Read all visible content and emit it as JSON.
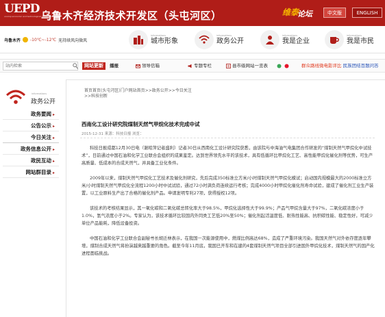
{
  "header": {
    "logo_text": "UEPD",
    "logo_sub": "urumqi economic and technological development zone",
    "site_title": "乌鲁木齐经济技术开发区（头屯河区）",
    "forum_badge_1": "维泰",
    "forum_badge_2": "论坛",
    "lang_cn": "中文版",
    "lang_en": "ENGLISH",
    "colors": {
      "brand": "#b01d18",
      "accent_yellow": "#f5b400"
    }
  },
  "weather": {
    "place": "乌鲁木齐",
    "temp": "-10℃~-12℃",
    "desc": "无持续风向微风"
  },
  "nav": [
    {
      "en": "informations",
      "cn": "城市形象",
      "icon": "building-icon"
    },
    {
      "en": "informations",
      "cn": "政务公开",
      "icon": "wifi-icon"
    },
    {
      "en": "informations",
      "cn": "我是企业",
      "icon": "person-icon"
    },
    {
      "en": "informations",
      "cn": "我是市民",
      "icon": "cup-icon"
    }
  ],
  "toolbar": {
    "search_placeholder": "站内检索",
    "tag": "网站更新",
    "tag_tail": "播报",
    "links": [
      "领导信箱",
      "专题专栏",
      "县市级网站一览表",
      "微信",
      "微博"
    ],
    "marquee_1": "群众路线微电影评比",
    "marquee_2": "民族团结百题问答"
  },
  "sidebar": {
    "en": "informations",
    "title": "政务公开",
    "items": [
      "政务要闻",
      "公告公示",
      "今日关注",
      "政务信息公开",
      "政民互动",
      "网站群目录"
    ]
  },
  "article": {
    "crumb": "首页首页(头屯河区)门户网站首页>>政务公开>>今日关注>>科技创新",
    "title": "西南化工设计研究院煤制天然气甲烷化技术完成中试",
    "meta": "2015-12-31 来源：科技日报 浏览：",
    "paragraphs": [
      "科技日报成都12月30日电（谢昭萍记者盛利）记者30日从西南化工设计研究院获悉，由该院与中海油气电集团合作研发的“煤制天然气甲烷化中试技术”，日前通过中国石油和化学工业联合会组织的成果鉴定。达到世界领先水平的该技术，具有低循环比甲烷化工艺、高性能甲烷化催化剂等优势，可生产高质量、低成本的合成天然气，并具备工业化条件。",
      "2009年以来，煤制天然气甲烷化工艺技术及催化剂研究，先后完成350标准立方米/小时煤制天然气甲烷化模试；启动国内规模最大的2000标准立方米/小时煤制天然气甲烷化全流程1200小时中试试验，通过72小时满负荷连续运行考核；完成4000小时甲烷化催化剂寿命试验，建成了催化剂工业生产装置，以工业原料生产出了合格的催化剂产品。申请发明专利27项，获得授权12项。",
      "该技术的考核结果显示，其一氧化碳和二氧化碳总转化率大于98.5%，甲烷化选择性大于99.9%；产品气甲烷含量大于97%，二氧化碳浓度小于1.0%，氢气浓度小于2%。专家认为，该技术循环比较国内外同类工艺低20%至50%；催化剂起活温度低、耐热性能高、抗积碳性能、稳定性好，可减少单位产品能耗，降低设备投资。",
      "中国石油和化学工业联合会副秘书长胡迁林表示，在我国一次能源使用中，燃煤比例高达68%，造成了严重环境污染。我国天然气对外依存度逐年攀增，煤制合成天然气将扮演越来越重要的角色。截至今年11月底，我国已开车和在建的4套煤制天然气项目全部引进国外甲烷化技术，煤制天然气的国产化进程面临挑战。"
    ]
  }
}
